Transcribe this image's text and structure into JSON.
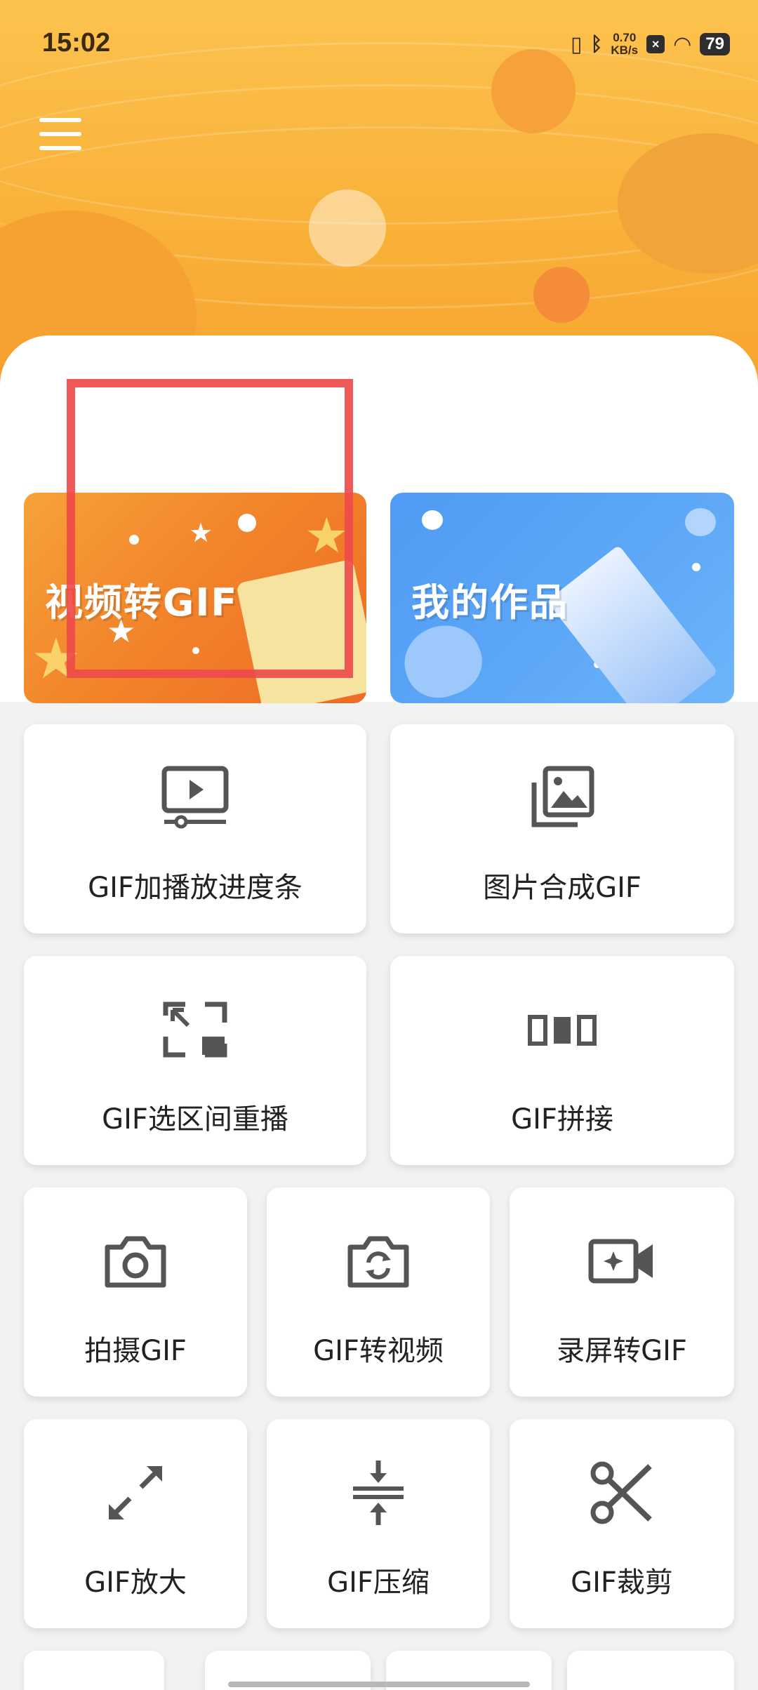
{
  "status_bar": {
    "time": "15:02",
    "net_speed_top": "0.70",
    "net_speed_bottom": "KB/s",
    "battery": "79",
    "x_badge": "×"
  },
  "header": {
    "menu_icon": "hamburger-menu-icon"
  },
  "banners": [
    {
      "label": "视频转GIF",
      "color": "#f2852b"
    },
    {
      "label": "我的作品",
      "color": "#5ea8f7"
    }
  ],
  "tools": [
    {
      "label": "GIF加播放进度条",
      "icon": "video-progress-icon"
    },
    {
      "label": "图片合成GIF",
      "icon": "photo-stack-icon"
    },
    {
      "label": "GIF选区间重播",
      "icon": "range-expand-icon"
    },
    {
      "label": "GIF拼接",
      "icon": "splice-frames-icon"
    },
    {
      "label": "拍摄GIF",
      "icon": "camera-icon"
    },
    {
      "label": "GIF转视频",
      "icon": "camera-rotate-icon"
    },
    {
      "label": "录屏转GIF",
      "icon": "video-record-icon"
    },
    {
      "label": "GIF放大",
      "icon": "expand-arrows-icon"
    },
    {
      "label": "GIF压缩",
      "icon": "compress-icon"
    },
    {
      "label": "GIF裁剪",
      "icon": "scissors-icon"
    }
  ]
}
